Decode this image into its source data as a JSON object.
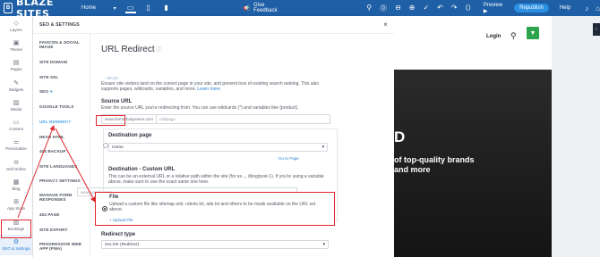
{
  "topbar": {
    "logo_mark": "B",
    "brand": "BLAZE SITES",
    "page": "Home",
    "page_chevron": "▾",
    "devices": [
      "▭",
      "▯",
      "▮"
    ],
    "feedback_icon": "megaphone-icon",
    "feedback": "Give Feedback",
    "preview": "Preview ▶",
    "republish": "Republish",
    "help": "Help"
  },
  "rail": {
    "items": [
      {
        "icon": "layers-icon",
        "glyph": "◇",
        "label": "Layers"
      },
      {
        "icon": "theme-icon",
        "glyph": "▣",
        "label": "Theme"
      },
      {
        "icon": "pages-icon",
        "glyph": "▤",
        "label": "Pages"
      },
      {
        "icon": "widgets-icon",
        "glyph": "✎",
        "label": "Widgets"
      },
      {
        "icon": "media-icon",
        "glyph": "▨",
        "label": "Media"
      },
      {
        "icon": "content-icon",
        "glyph": "▭",
        "label": "Content"
      },
      {
        "icon": "personalize-icon",
        "glyph": "⚌",
        "label": "Personalize"
      },
      {
        "icon": "sell-online-icon",
        "glyph": "⊖",
        "label": "Sell Online"
      },
      {
        "icon": "blog-icon",
        "glyph": "▦",
        "label": "Blog"
      },
      {
        "icon": "app-store-icon",
        "glyph": "⊞",
        "label": "App Store"
      },
      {
        "icon": "bookings-icon",
        "glyph": "▥",
        "label": "Bookings"
      },
      {
        "icon": "seo-settings-icon",
        "glyph": "⚙",
        "label": "SEO & Settings"
      }
    ]
  },
  "panel": {
    "title": "SEO & SETTINGS",
    "close": "×",
    "nav": [
      "FAVICON & SOCIAL IMAGE",
      "SITE DOMAIN",
      "SITE SSL",
      "SEO",
      "GOOGLE TOOLS",
      "URL REDIRECT",
      "HEAD HTML",
      "404 BACKUP",
      "SITE LANGUAGES",
      "PRIVACY SETTINGS",
      "MANAGE FORM RESPONSES",
      "404 PAGE",
      "SITE EXPORT",
      "PROGRESSIVE WEB APP (PWA)"
    ],
    "seo_star": "✦",
    "content": {
      "title": "URL Redirect",
      "info_icon": "ⓘ",
      "back": "‹ BACK",
      "desc": "Ensure site visitors land on the correct page in your site, and prevent loss of existing search ranking. This also supports pages, wildcards, variables, and more.",
      "learn_more": "Learn more",
      "source_label": "Source URL",
      "source_help": "Enter the source URL you're redirecting from. You can use wildcards (*) and variables like {product}.",
      "source_prefix": "www.theherbalgreens.com",
      "source_placeholder": "/oldpage",
      "dest_page_label": "Destination page",
      "dest_page_value": "Home",
      "go_to_page": "Go to Page",
      "custom_label": "Destination - Custom URL",
      "custom_help": "This can be an external URL or a relative path within the site (for ex..., /blog/post-1). If you're using a variable above, make sure to use the exact same one here.",
      "custom_placeholder": "www.google.com",
      "file_label": "File",
      "file_help": "Upload a custom file like sitemap.xml, robots.txt, ads.txt and others to be made available on the URL set above.",
      "upload": "+ Upload File",
      "redirect_type_label": "Redirect type",
      "redirect_type_value": "2xx.OK (Redirect)",
      "chevron": "▾"
    }
  },
  "site_preview": {
    "login": "Login",
    "search_icon": "⚲",
    "cart_icon": "🛒",
    "hero_letter": "D",
    "hero_text": "of top-quality brands and more",
    "collapse": "‹"
  },
  "colors": {
    "topbar": "#1f5fa6",
    "accent": "#2a8fe0",
    "annotation": "#e0242c",
    "cart": "#2da44e"
  }
}
